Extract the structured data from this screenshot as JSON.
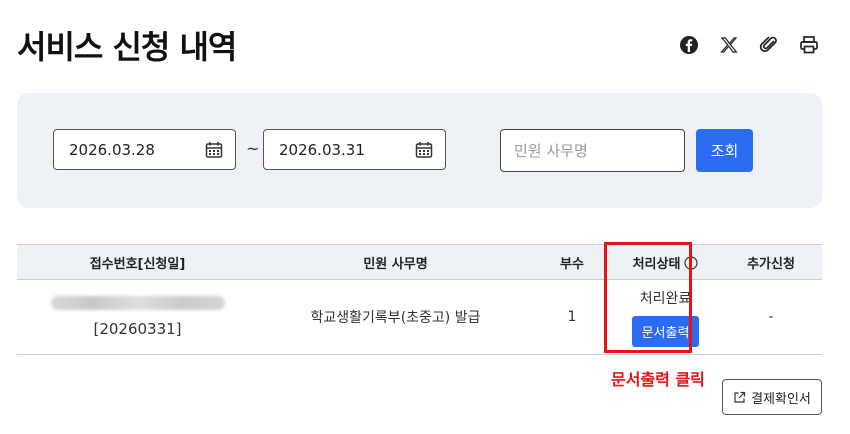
{
  "page": {
    "title": "서비스 신청 내역"
  },
  "share": {
    "icons": [
      "facebook-icon",
      "x-icon",
      "paperclip-icon",
      "print-icon"
    ]
  },
  "search": {
    "start_date": "2026.03.28",
    "separator": "~",
    "end_date": "2026.03.31",
    "keyword_placeholder": "민원 사무명",
    "submit_label": "조회"
  },
  "table": {
    "headers": {
      "receipt": "접수번호[신청일]",
      "service": "민원 사무명",
      "copies": "부수",
      "status": "처리상태",
      "extra": "추가신청"
    },
    "rows": [
      {
        "receipt_date": "[20260331]",
        "service": "학교생활기록부(초중고) 발급",
        "copies": "1",
        "status": "처리완료",
        "print_label": "문서출력",
        "extra": "-"
      }
    ]
  },
  "annotation": {
    "text": "문서출력 클릭",
    "color": "#e3151a"
  },
  "payment_button": {
    "label": "결제확인서"
  },
  "colors": {
    "accent": "#2b6cf0",
    "panel": "#eef1f6",
    "highlight": "#e3151a"
  }
}
